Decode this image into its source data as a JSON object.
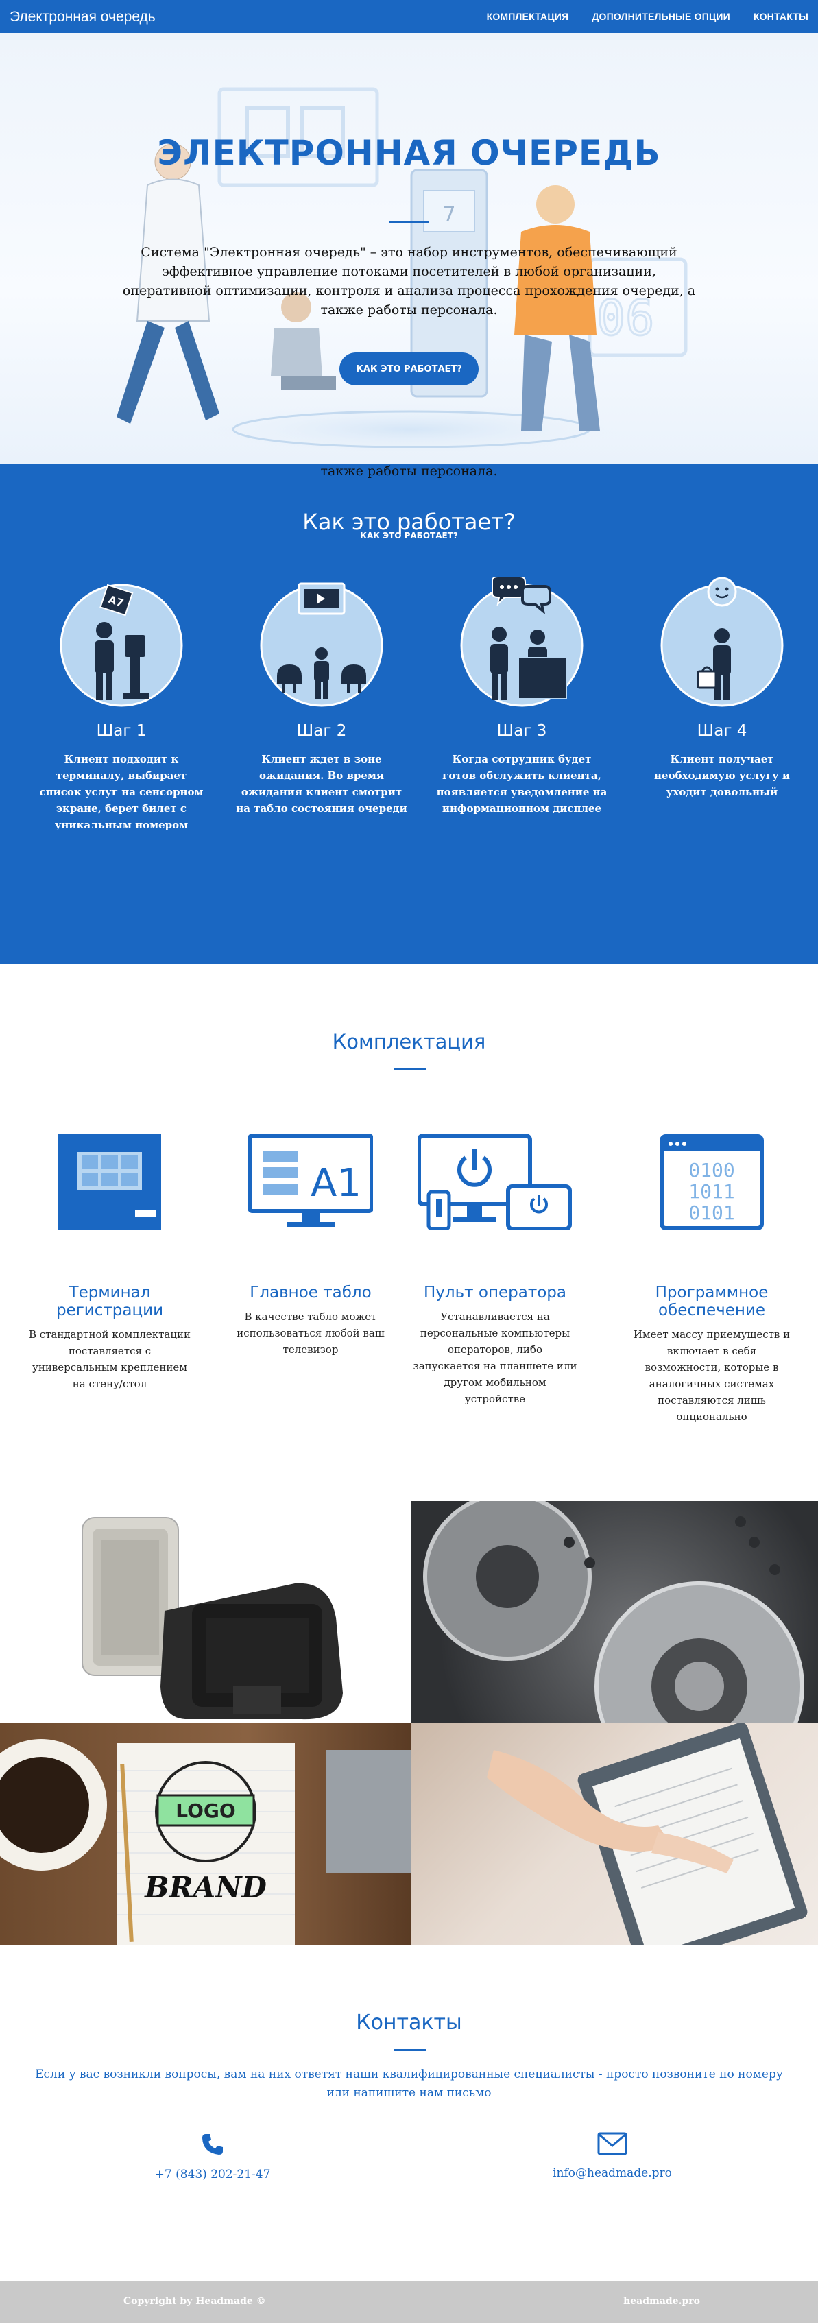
{
  "nav": {
    "brand": "Электронная очередь",
    "links": [
      "КОМПЛЕКТАЦИЯ",
      "ДОПОЛНИТЕЛЬНЫЕ ОПЦИИ",
      "КОНТАКТЫ"
    ]
  },
  "hero": {
    "title": "ЭЛЕКТРОННАЯ ОЧЕРЕДЬ",
    "description": "Система \"Электронная очередь\" – это набор инструментов, обеспечивающий эффективное управление потоками посетителей в любой организации, оперативной оптимизации, контроля и анализа процесса прохождения очереди, а также работы персонала.",
    "button": "КАК ЭТО РАБОТАЕТ?",
    "overflow_text": "также работы персонала.",
    "board_digit": "7",
    "colors": {
      "accent": "#1a67c2"
    }
  },
  "how": {
    "title": "Как это работает?",
    "subtitle": "КАК ЭТО РАБОТАЕТ?",
    "steps": [
      {
        "title": "Шаг 1",
        "text": "Клиент подходит к терминалу, выбирает список услуг на сенсорном экране, берет билет с уникальным номером",
        "icon": "terminal-person-icon"
      },
      {
        "title": "Шаг 2",
        "text": "Клиент ждет в зоне ожидания. Во время ожидания клиент смотрит на табло состояния очереди",
        "icon": "waiting-area-icon"
      },
      {
        "title": "Шаг 3",
        "text": "Когда сотрудник будет готов обслужить клиента, появляется уведомление на информационном дисплее",
        "icon": "service-desk-icon"
      },
      {
        "title": "Шаг 4",
        "text": "Клиент получает необходимую услугу и уходит довольный",
        "icon": "happy-client-icon"
      }
    ],
    "ticket_label": "A7"
  },
  "kit": {
    "title": "Комплектация",
    "items": [
      {
        "name": "Терминал регистрации",
        "text": "В стандартной комплектации поставляется с универсальным креплением на стену/стол",
        "icon": "terminal-icon"
      },
      {
        "name": "Главное табло",
        "text": "В качестве табло может использоваться любой ваш телевизор",
        "icon": "display-board-icon"
      },
      {
        "name": "Пульт оператора",
        "text": "Устанавливается на персональные компьютеры операторов, либо запускается на планшете или другом мобильном устройстве",
        "icon": "operator-console-icon"
      },
      {
        "name": "Программное обеспечение",
        "text": "Имеет массу приемуществ и включает в себя возможности, которые в аналогичных системах поставляются лишь опционально",
        "icon": "software-icon"
      }
    ],
    "board_label": "A1",
    "binary_rows": [
      "0100",
      "1011",
      "0101"
    ]
  },
  "gallery": {
    "images": [
      "speakers-image",
      "gears-image",
      "logo-brand-image",
      "document-signing-image"
    ],
    "logo_text": "LOGO",
    "brand_text": "BRAND"
  },
  "contacts": {
    "title": "Контакты",
    "text": "Если у вас возникли вопросы, вам на них ответят наши квалифицированные специалисты - просто позвоните по номеру или напишите нам письмо",
    "phone": "+7 (843) 202-21-47",
    "email": "info@headmade.pro"
  },
  "footer": {
    "copyright": "Copyright by Headmade ©",
    "site": "headmade.pro"
  }
}
